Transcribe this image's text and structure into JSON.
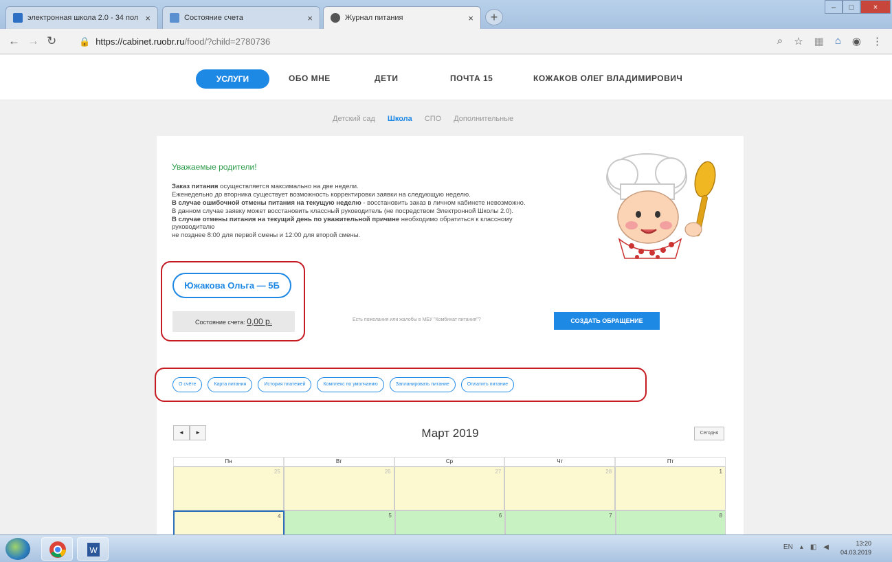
{
  "browser": {
    "tabs": [
      {
        "title": "электронная школа 2.0 - 34 пол",
        "icon_color": "#2f6fc4"
      },
      {
        "title": "Состояние счета",
        "icon_color": "#5a8fd0"
      },
      {
        "title": "Журнал питания",
        "icon_color": "#555555"
      }
    ],
    "url_host": "https://cabinet.ruobr.ru",
    "url_path": "/food/?child=2780736"
  },
  "header": {
    "nav": [
      {
        "label": "УСЛУГИ"
      },
      {
        "label": "ОБО МНЕ"
      },
      {
        "label": "ДЕТИ"
      },
      {
        "label": "ПОЧТА 15"
      },
      {
        "label": "КОЖАКОВ ОЛЕГ ВЛАДИМИРОВИЧ"
      }
    ]
  },
  "subnav": [
    "Детский сад",
    "Школа",
    "СПО",
    "Дополнительные"
  ],
  "notice": {
    "greeting": "Уважаемые родители!",
    "lines": [
      {
        "bold": "Заказ питания",
        "text": " осуществляется максимально на две недели."
      },
      {
        "bold": "",
        "text": "Еженедельно до вторника существует возможность корректировки заявки на следующую неделю."
      },
      {
        "bold": "В случае ошибочной отмены питания на текущую неделю",
        "text": " - восстановить заказ в личном кабинете невозможно."
      },
      {
        "bold": "",
        "text": "В данном случае заявку может восстановить классный руководитель (не посредством Электронной Школы 2.0)."
      },
      {
        "bold": "В случае отмены питания на текущий день по уважительной причине",
        "text": " необходимо обратиться к классному"
      },
      {
        "bold": "",
        "text": "руководителю"
      },
      {
        "bold": "",
        "text": "не позднее 8:00 для первой смены и 12:00 для второй смены."
      }
    ]
  },
  "child": {
    "name": "Южакова Ольга — 5Б",
    "balance_label": "Состояние счета:",
    "balance_value": "0,00 р."
  },
  "complaint_text": "Есть пожелания или жалобы в МБУ \"Комбинат питания\"?",
  "create_button": "СОЗДАТЬ ОБРАЩЕНИЕ",
  "actions": [
    "О счёте",
    "Карта питания",
    "История платежей",
    "Комплекс по умолчанию",
    "Запланировать питание",
    "Оплатить питание"
  ],
  "calendar": {
    "title": "Март 2019",
    "prev": "◄",
    "next": "►",
    "today": "Сегодня",
    "weekdays": [
      "Пн",
      "Вт",
      "Ср",
      "Чт",
      "Пт"
    ],
    "week1": [
      "25",
      "26",
      "27",
      "28",
      "1"
    ],
    "week2": [
      "4",
      "5",
      "6",
      "7",
      "8"
    ]
  },
  "taskbar": {
    "lang": "EN",
    "time": "13:20",
    "date": "04.03.2019"
  },
  "colors": {
    "accent": "#1e88e5",
    "highlight": "#c61a22",
    "greeting": "#2e9c4b",
    "day_past": "#fcf8d0",
    "day_future": "#c9f2c2"
  }
}
